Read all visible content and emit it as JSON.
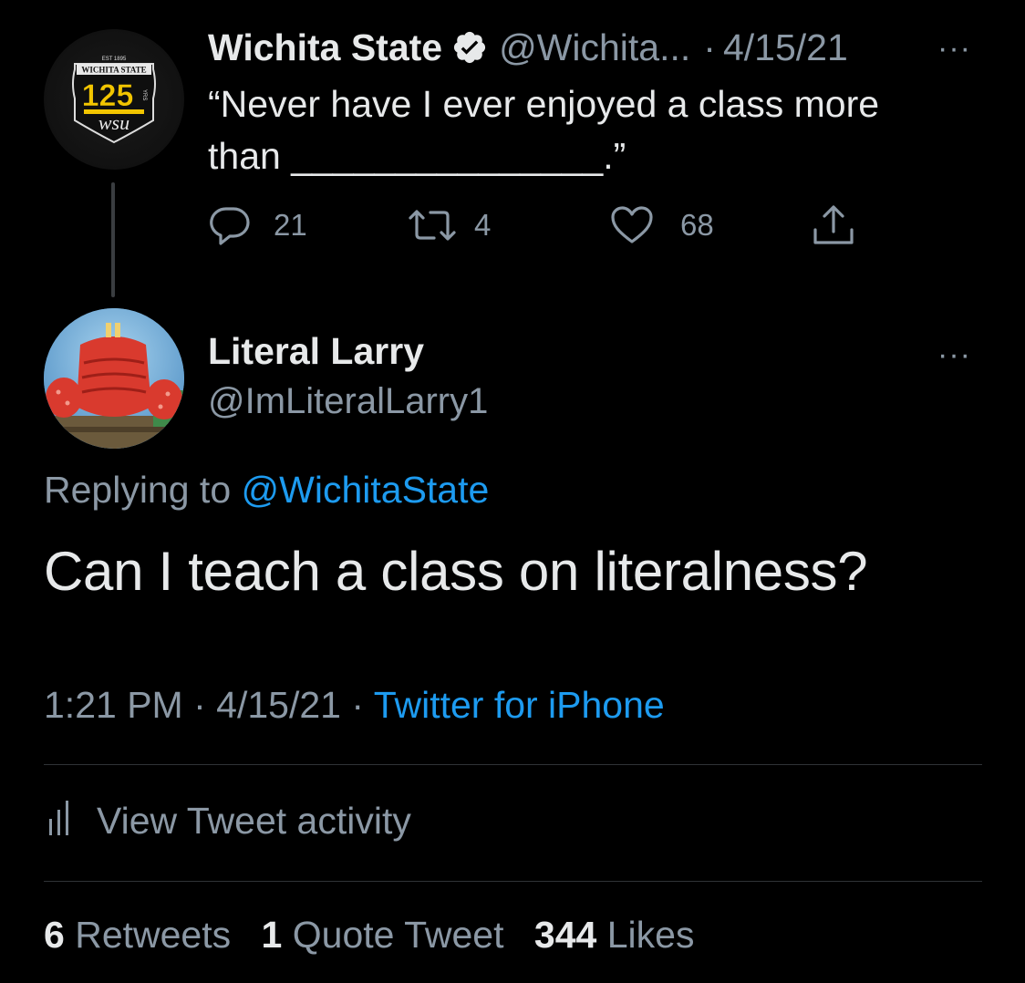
{
  "parent_tweet": {
    "avatar": {
      "icon": "wichita-state-125-logo",
      "est_text": "EST 1895",
      "school_text": "WICHITA STATE",
      "number_text": "125",
      "years_text": "YRS",
      "wsu_text": "wsu"
    },
    "name": "Wichita State",
    "verified_icon": "verified-badge-icon",
    "handle": "@Wichita...",
    "separator": "·",
    "date": "4/15/21",
    "more_icon": "more-horizontal-icon",
    "more_text": "···",
    "text_line1": "“Never have I ever enjoyed a class more",
    "text_line2": "than _______________.”",
    "actions": {
      "reply_icon": "reply-icon",
      "reply_count": "21",
      "retweet_icon": "retweet-icon",
      "retweet_count": "4",
      "like_icon": "heart-icon",
      "like_count": "68",
      "share_icon": "share-icon"
    }
  },
  "reply_tweet": {
    "avatar_icon": "larry-the-lobster-avatar",
    "name": "Literal Larry",
    "handle": "@ImLiteralLarry1",
    "more_icon": "more-horizontal-icon",
    "more_text": "···",
    "replying_prefix": "Replying to",
    "replying_handle": "@WichitaState",
    "text": "Can I teach a class on literalness?",
    "time": "1:21 PM",
    "separator": "·",
    "date": "4/15/21",
    "source": "Twitter for iPhone",
    "activity_icon": "analytics-bars-icon",
    "activity_label": "View Tweet activity",
    "stats": {
      "retweets_count": "6",
      "retweets_label": "Retweets",
      "quotes_count": "1",
      "quotes_label": "Quote Tweet",
      "likes_count": "344",
      "likes_label": "Likes"
    }
  },
  "colors": {
    "background": "#000000",
    "primary_text": "#e7e9ea",
    "secondary_text": "#8b98a5",
    "link": "#1d9bf0",
    "divider": "#2f3336",
    "wsu_gold": "#f2c500"
  }
}
